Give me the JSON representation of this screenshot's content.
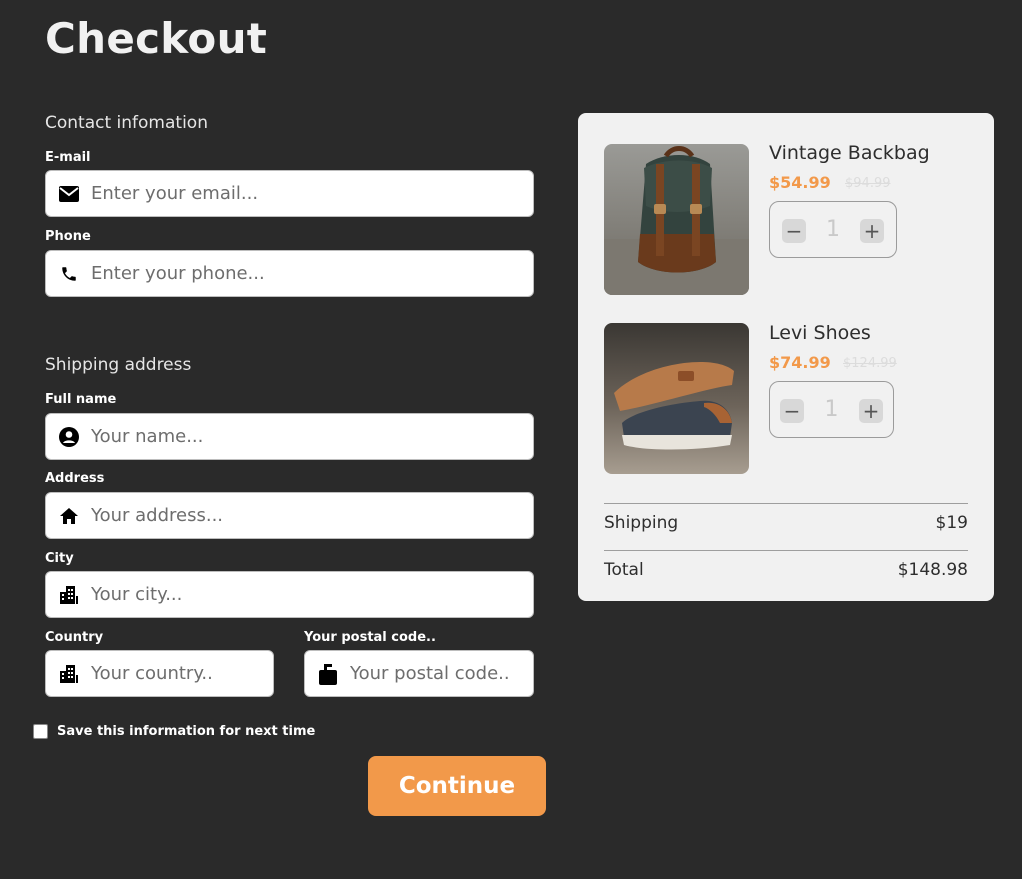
{
  "page": {
    "title": "Checkout"
  },
  "contact": {
    "heading": "Contact infomation",
    "email": {
      "label": "E-mail",
      "placeholder": "Enter your email...",
      "icon": "mail-icon"
    },
    "phone": {
      "label": "Phone",
      "placeholder": "Enter your phone...",
      "icon": "phone-icon"
    }
  },
  "shipping": {
    "heading": "Shipping address",
    "full_name": {
      "label": "Full name",
      "placeholder": "Your name...",
      "icon": "user-icon"
    },
    "address": {
      "label": "Address",
      "placeholder": "Your address...",
      "icon": "home-icon"
    },
    "city": {
      "label": "City",
      "placeholder": "Your city...",
      "icon": "building-icon"
    },
    "country": {
      "label": "Country",
      "placeholder": "Your country..",
      "icon": "building-icon"
    },
    "postal": {
      "label": "Your postal code..",
      "placeholder": "Your postal code..",
      "icon": "mailbox-icon"
    }
  },
  "save_info": {
    "label": "Save this information for next time",
    "checked": false
  },
  "continue_label": "Continue",
  "cart": {
    "items": [
      {
        "name": "Vintage Backbag",
        "price": "$54.99",
        "old_price": "$94.99",
        "quantity": "1"
      },
      {
        "name": "Levi Shoes",
        "price": "$74.99",
        "old_price": "$124.99",
        "quantity": "1"
      }
    ],
    "shipping": {
      "label": "Shipping",
      "value": "$19"
    },
    "total": {
      "label": "Total",
      "value": "$148.98"
    }
  },
  "colors": {
    "background": "#2a2a2a",
    "accent": "#f2994a",
    "card": "#f1f1f1"
  }
}
